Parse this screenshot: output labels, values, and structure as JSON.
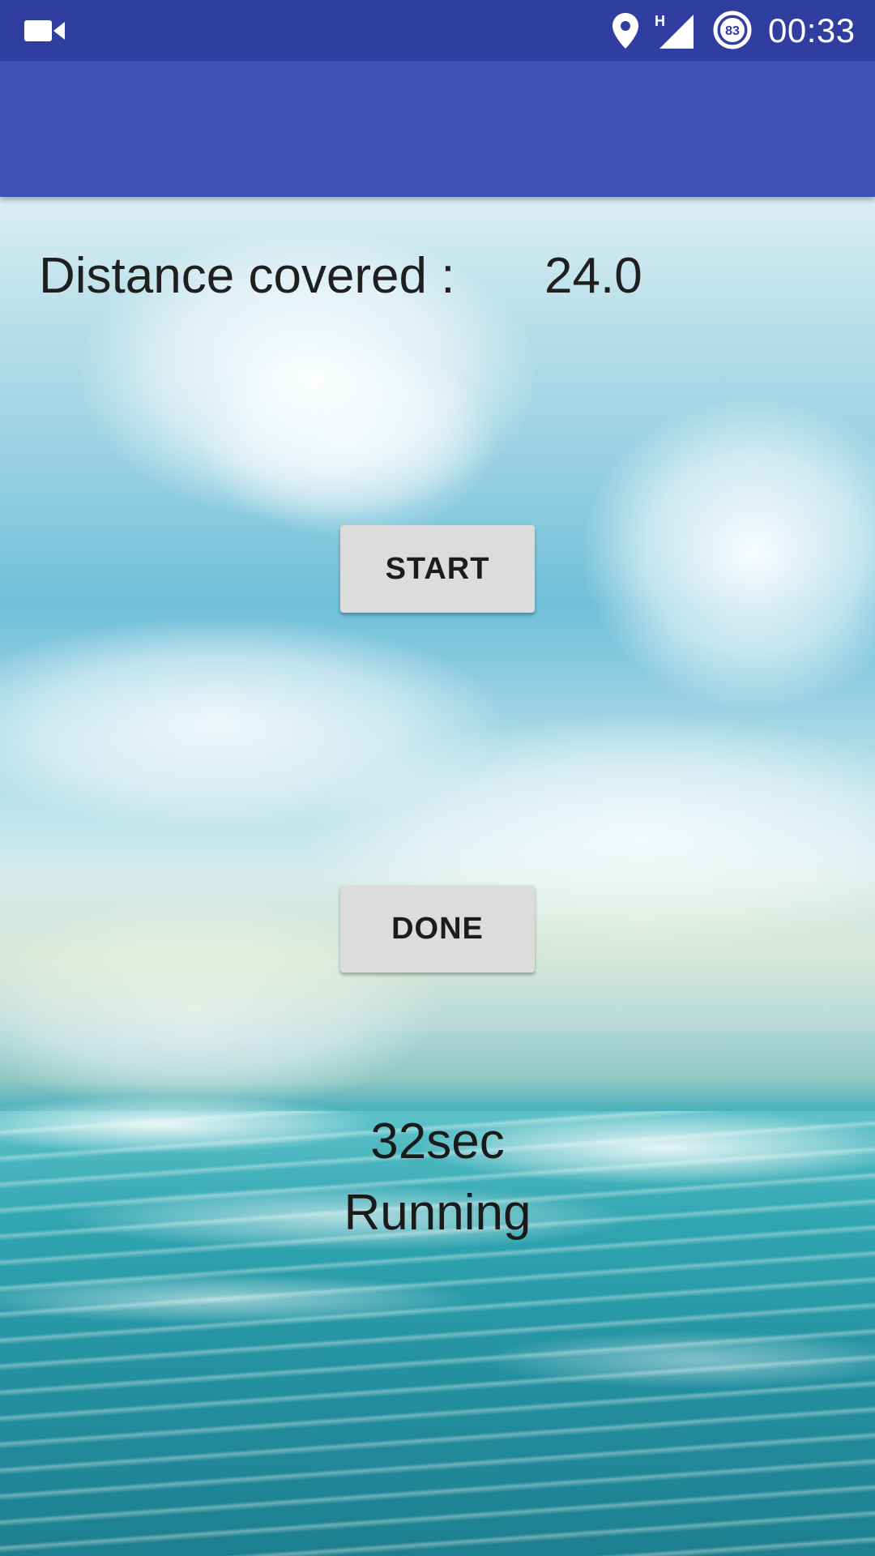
{
  "status_bar": {
    "time": "00:33",
    "battery_level": "83",
    "network_type": "H",
    "left_icon": "video-camera-icon",
    "right_icons": [
      "location-pin-icon",
      "cell-signal-icon",
      "battery-icon"
    ],
    "background_color": "#303f9f"
  },
  "app_bar": {
    "title": "",
    "background_color": "#3f51b5"
  },
  "main": {
    "distance_label": "Distance covered :",
    "distance_value": "24.0",
    "start_button_label": "START",
    "done_button_label": "DONE",
    "timer_text": "32sec",
    "status_text": "Running",
    "background": "sky-and-ocean-image",
    "button_color": "#dddcdd"
  }
}
